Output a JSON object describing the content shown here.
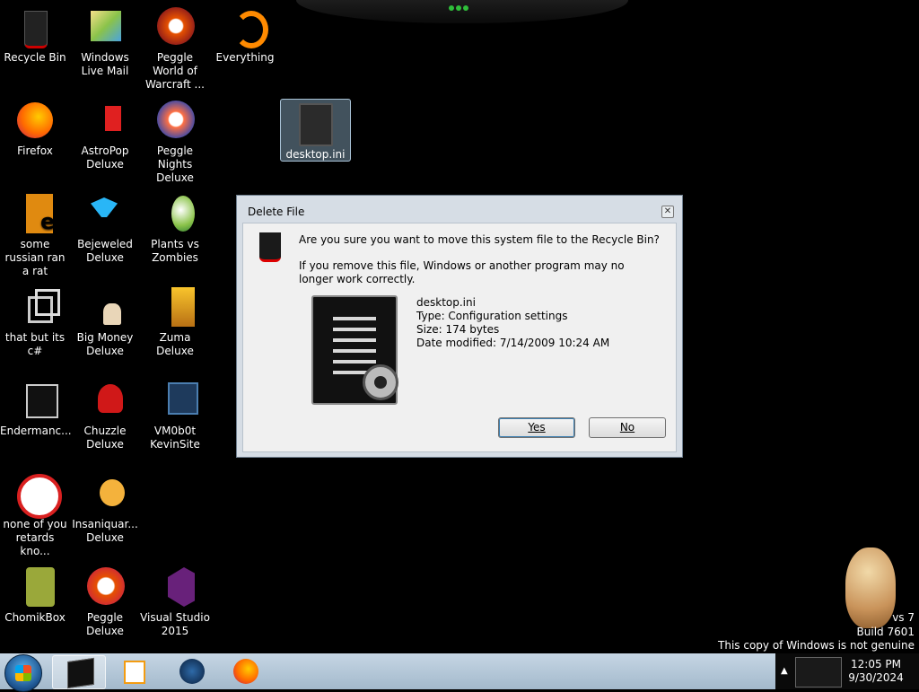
{
  "desktop_icons": [
    {
      "label": "Recycle Bin",
      "icon": "recycle-bin-icon"
    },
    {
      "label": "Windows Live Mail",
      "icon": "windows-live-mail-icon"
    },
    {
      "label": "Peggle World of Warcraft ...",
      "icon": "peggle-wow-icon"
    },
    {
      "label": "Everything",
      "icon": "everything-icon"
    },
    {
      "label": "Firefox",
      "icon": "firefox-icon"
    },
    {
      "label": "AstroPop Deluxe",
      "icon": "astropop-icon"
    },
    {
      "label": "Peggle Nights Deluxe",
      "icon": "peggle-nights-icon"
    },
    {
      "label": "some russian ran a rat",
      "icon": "russian-rat-icon"
    },
    {
      "label": "Bejeweled Deluxe",
      "icon": "bejeweled-icon"
    },
    {
      "label": "Plants vs Zombies",
      "icon": "plants-vs-zombies-icon"
    },
    {
      "label": "that but its c#",
      "icon": "csharp-icon"
    },
    {
      "label": "Big Money Deluxe",
      "icon": "big-money-icon"
    },
    {
      "label": "Zuma Deluxe",
      "icon": "zuma-icon"
    },
    {
      "label": "Endermanc...",
      "icon": "enderman-icon"
    },
    {
      "label": "Chuzzle Deluxe",
      "icon": "chuzzle-icon"
    },
    {
      "label": "VM0b0t KevinSite",
      "icon": "vm0b0t-icon"
    },
    {
      "label": "none of you retards kno...",
      "icon": "none-of-you-icon"
    },
    {
      "label": "Insaniquar... Deluxe",
      "icon": "insaniquarium-icon"
    },
    {
      "label": "ChomikBox",
      "icon": "chomikbox-icon"
    },
    {
      "label": "Peggle Deluxe",
      "icon": "peggle-deluxe-icon"
    },
    {
      "label": "Visual Studio 2015",
      "icon": "visual-studio-icon"
    },
    {
      "label": "desktop.ini",
      "icon": "config-file-icon"
    }
  ],
  "dialog": {
    "title": "Delete File",
    "close_glyph": "✕",
    "question": "Are you sure you want to move this system file to the Recycle Bin?",
    "warning": "If you remove this file, Windows or another program may no longer work correctly.",
    "file_name": "desktop.ini",
    "file_type": "Type: Configuration settings",
    "file_size": "Size: 174 bytes",
    "file_date": "Date modified: 7/14/2009 10:24 AM",
    "yes_label": "Yes",
    "no_label": "No"
  },
  "watermark": {
    "line1": "vs 7",
    "line2": "Build 7601",
    "line3": "This copy of Windows is not genuine"
  },
  "taskbar": {
    "pinned": [
      "file-manager-icon",
      "media-player-icon",
      "browser-icon",
      "firefox-icon"
    ]
  },
  "clock": {
    "time": "12:05 PM",
    "date": "9/30/2024"
  },
  "colors": {
    "desktop_bg": "#000000",
    "dialog_bg": "#f0f0f0",
    "taskbar": "#b3c7d9"
  }
}
